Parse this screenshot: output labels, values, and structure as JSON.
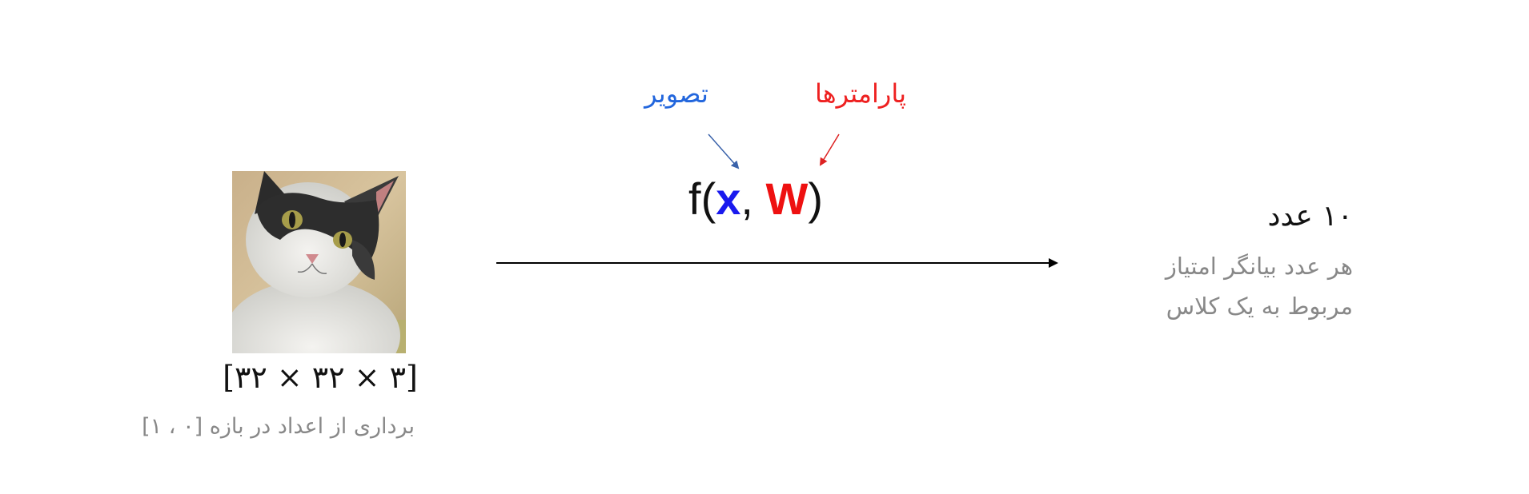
{
  "input": {
    "dimensions": "[۳۲ × ۳۲ × ۳]",
    "description": "برداری از اعداد در بازه [۰ ، ۱]"
  },
  "function": {
    "name": "f",
    "x": "x",
    "w": "W",
    "x_label": "تصویر",
    "w_label": "پارامترها",
    "x_color": "#1a1aee",
    "w_color": "#ee1111"
  },
  "output": {
    "title": "۱۰ عدد",
    "description_line1": "هر عدد بیانگر امتیاز",
    "description_line2": "مربوط به یک کلاس"
  }
}
